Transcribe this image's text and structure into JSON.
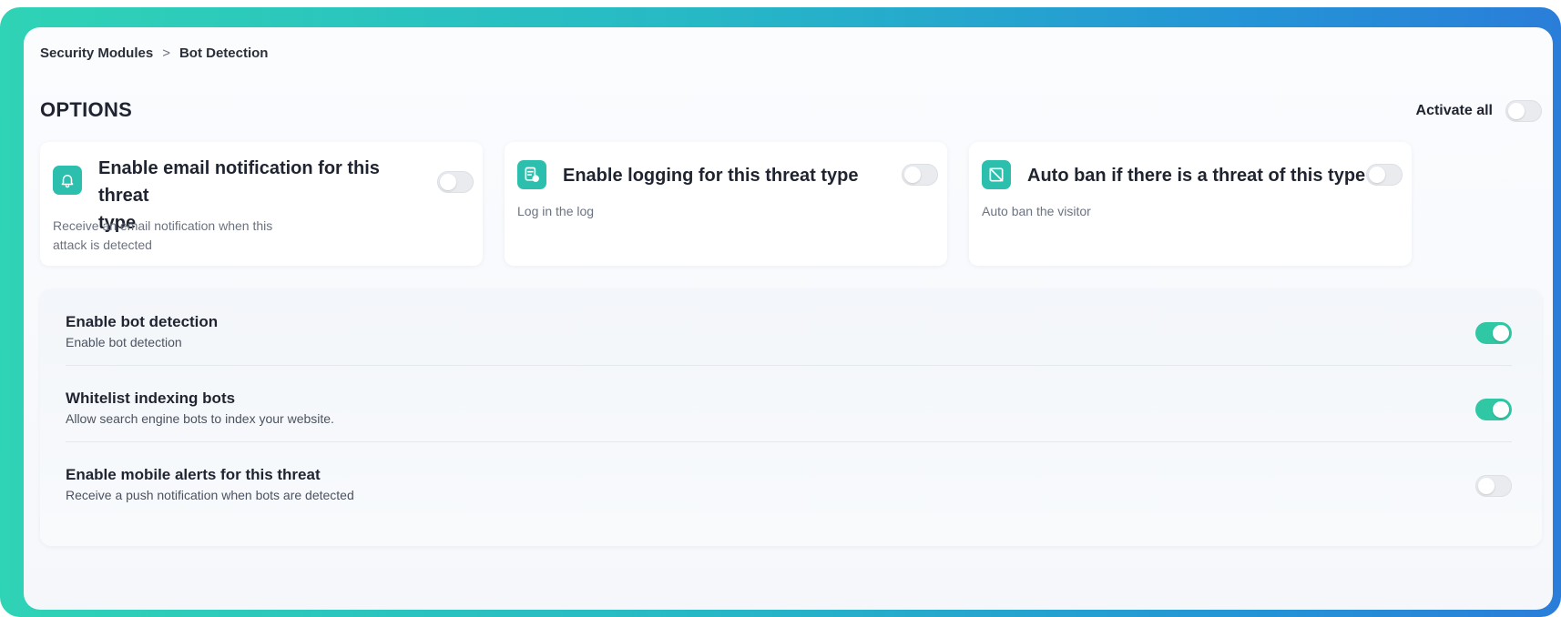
{
  "breadcrumb": {
    "parent": "Security Modules",
    "separator": ">",
    "current": "Bot Detection"
  },
  "options": {
    "title": "OPTIONS",
    "activate_all_label": "Activate all",
    "activate_all_on": false
  },
  "cards": [
    {
      "icon": "bell-icon",
      "title_line1": "Enable email notification for this threat",
      "title_line2": "type",
      "description_line1": "Receive an email notification when this",
      "description_line2": "attack is detected",
      "enabled": false
    },
    {
      "icon": "log-document-icon",
      "title": "Enable logging for this threat type",
      "description": "Log in the log",
      "enabled": false
    },
    {
      "icon": "ban-icon",
      "title": "Auto ban if there is a threat of this type",
      "description": "Auto ban the visitor",
      "enabled": false
    }
  ],
  "settings": [
    {
      "title": "Enable bot detection",
      "description": "Enable bot detection",
      "enabled": true
    },
    {
      "title": "Whitelist indexing bots",
      "description": "Allow search engine bots to index your website.",
      "enabled": true
    },
    {
      "title": "Enable mobile alerts for this threat",
      "description": "Receive a push notification when bots are detected",
      "enabled": false
    }
  ],
  "colors": {
    "accent": "#2fc7a4",
    "icon_bg": "#2dbfae",
    "frame_start": "#2fd3b5",
    "frame_end": "#2a7ed9"
  }
}
